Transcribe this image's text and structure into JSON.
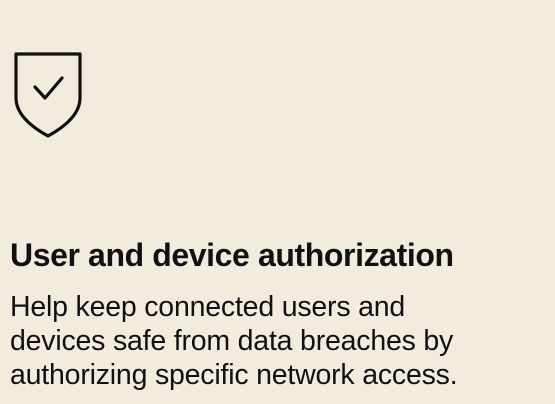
{
  "feature": {
    "icon": "shield-check-icon",
    "title": "User and device authorization",
    "description_lines": [
      "Help keep connected users and",
      "devices safe from data breaches by",
      "authorizing specific network access."
    ]
  },
  "colors": {
    "background": "#f2ecdf",
    "text": "#111111"
  }
}
